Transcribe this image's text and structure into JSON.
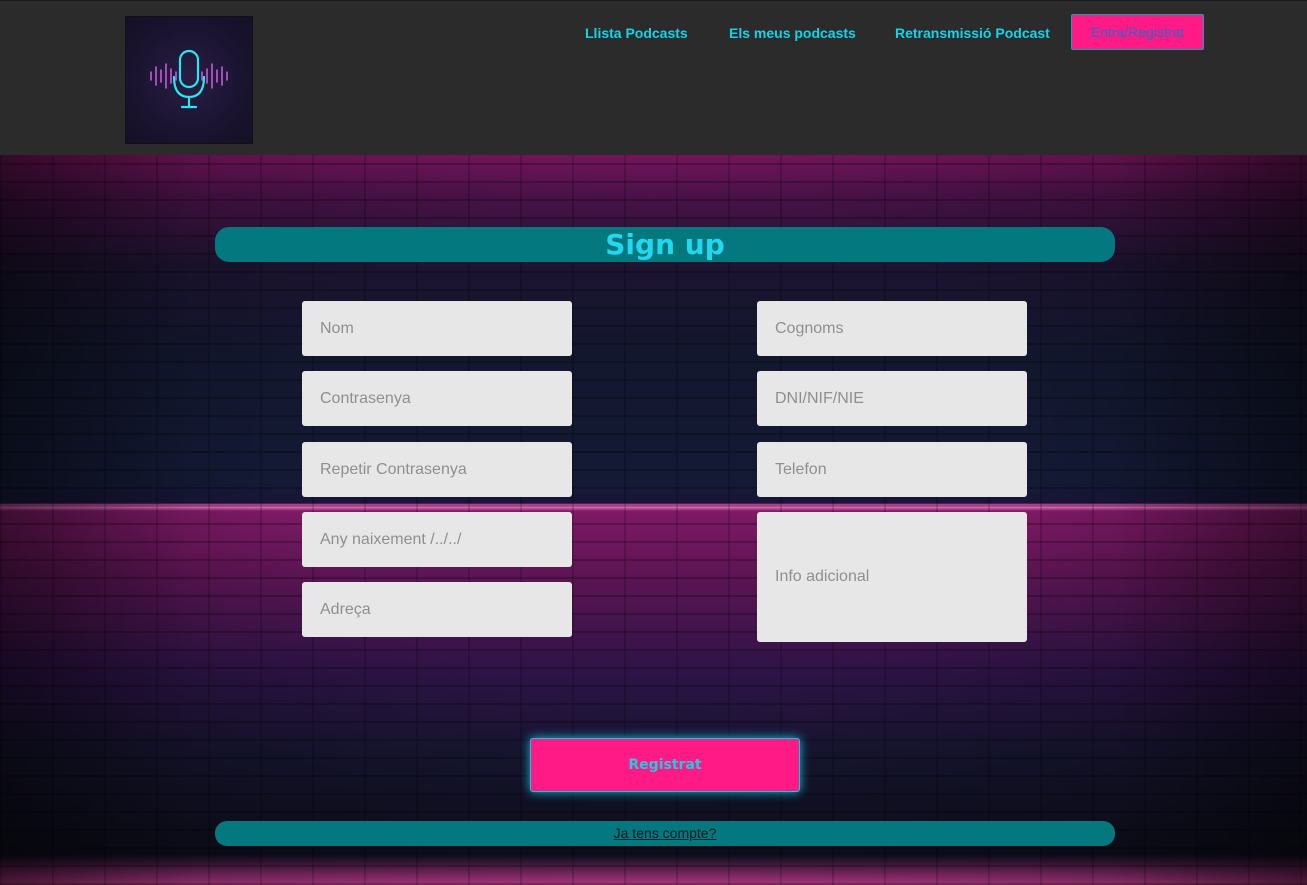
{
  "nav": {
    "items": [
      {
        "label": "Llista Podcasts"
      },
      {
        "label": "Els meus podcasts"
      },
      {
        "label": "Retransmissió Podcast"
      }
    ],
    "cta_label": "Entra/Registrat"
  },
  "form": {
    "title": "Sign up",
    "fields": {
      "nom": "Nom",
      "cognoms": "Cognoms",
      "contrasenya": "Contrasenya",
      "dni": "DNI/NIF/NIE",
      "repetir": "Repetir Contrasenya",
      "telefon": "Telefon",
      "any": "Any naixement /../../",
      "adreca": "Adreça",
      "info": "Info adicional"
    },
    "submit_label": "Registrat",
    "login_link": "Ja tens compte?"
  },
  "colors": {
    "accent_cyan": "#12d4ea",
    "accent_pink": "#ff1a86",
    "teal_bar": "#04787f",
    "header_bg": "#2b2b2b"
  },
  "icons": {
    "logo": "microphone-neon-icon"
  }
}
